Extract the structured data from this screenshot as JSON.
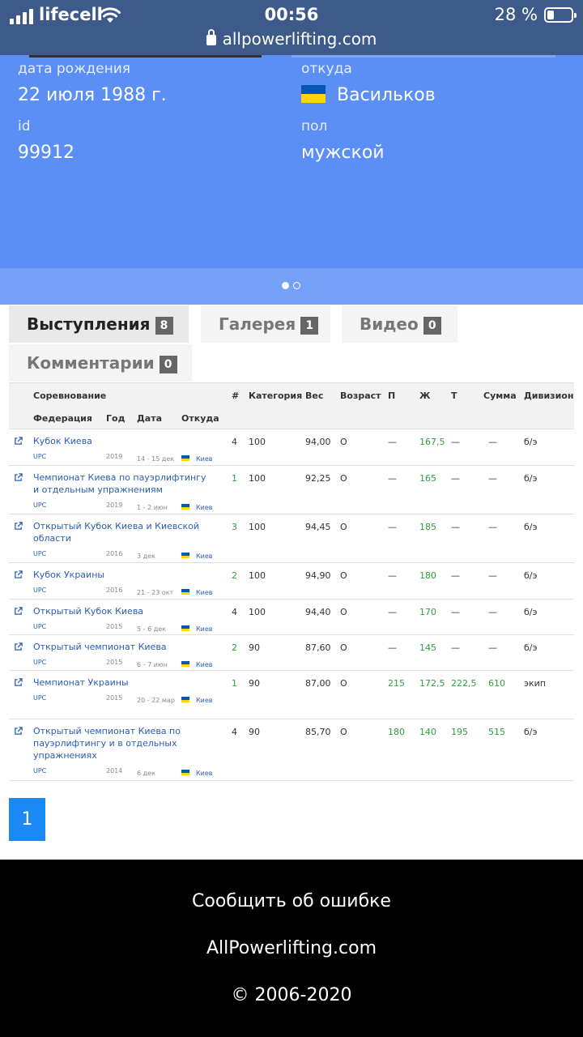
{
  "status_bar": {
    "carrier": "lifecell",
    "time": "00:56",
    "battery": "28 %",
    "url": "allpowerlifting.com"
  },
  "profile": {
    "birth_label": "дата рождения",
    "birth_value": "22 июля 1988 г.",
    "from_label": "откуда",
    "from_value": "Васильков",
    "id_label": "id",
    "id_value": "99912",
    "sex_label": "пол",
    "sex_value": "мужской"
  },
  "tabs": [
    {
      "label": "Выступления",
      "count": "8"
    },
    {
      "label": "Галерея",
      "count": "1"
    },
    {
      "label": "Видео",
      "count": "0"
    },
    {
      "label": "Комментарии",
      "count": "0"
    }
  ],
  "table": {
    "headers": {
      "competition": "Соревнование",
      "federation": "Федерация",
      "year": "Год",
      "date": "Дата",
      "from": "Откуда",
      "place": "#",
      "category": "Категория",
      "weight": "Вес",
      "age": "Возраст",
      "squat": "П",
      "bench": "Ж",
      "deadlift": "Т",
      "total": "Сумма",
      "division": "Дивизион"
    },
    "rows": [
      {
        "name": "Кубок Киева",
        "fed": "UPC",
        "year": "2019",
        "date": "14 - 15 дек",
        "city": "Киев",
        "place": "4",
        "cat": "100",
        "weight": "94,00",
        "age": "O",
        "squat": "—",
        "bench": "167,5",
        "dead": "—",
        "total": "—",
        "div": "б/э"
      },
      {
        "name": "Чемпионат Киева по пауэрлифтингу и отдельным упражнениям",
        "fed": "UPC",
        "year": "2019",
        "date": "1 - 2 июн",
        "city": "Киев",
        "place": "1",
        "cat": "100",
        "weight": "92,25",
        "age": "O",
        "squat": "—",
        "bench": "165",
        "dead": "—",
        "total": "—",
        "div": "б/э"
      },
      {
        "name": "Открытый Кубок Киева и Киевской области",
        "fed": "UPC",
        "year": "2016",
        "date": "3 дек",
        "city": "Киев",
        "place": "3",
        "cat": "100",
        "weight": "94,45",
        "age": "O",
        "squat": "—",
        "bench": "185",
        "dead": "—",
        "total": "—",
        "div": "б/э"
      },
      {
        "name": "Кубок Украины",
        "fed": "UPC",
        "year": "2016",
        "date": "21 - 23 окт",
        "city": "Киев",
        "place": "2",
        "cat": "100",
        "weight": "94,90",
        "age": "O",
        "squat": "—",
        "bench": "180",
        "dead": "—",
        "total": "—",
        "div": "б/э"
      },
      {
        "name": "Открытый Кубок Киева",
        "fed": "UPC",
        "year": "2015",
        "date": "5 - 6 дек",
        "city": "Киев",
        "place": "4",
        "cat": "100",
        "weight": "94,40",
        "age": "O",
        "squat": "—",
        "bench": "170",
        "dead": "—",
        "total": "—",
        "div": "б/э"
      },
      {
        "name": "Открытый чемпионат Киева",
        "fed": "UPC",
        "year": "2015",
        "date": "6 - 7 июн",
        "city": "Киев",
        "place": "2",
        "cat": "90",
        "weight": "87,60",
        "age": "O",
        "squat": "—",
        "bench": "145",
        "dead": "—",
        "total": "—",
        "div": "б/э"
      },
      {
        "name": "Чемпионат Украины",
        "fed": "UPC",
        "year": "2015",
        "date": "20 - 22 мар",
        "city": "Киев",
        "place": "1",
        "cat": "90",
        "weight": "87,00",
        "age": "O",
        "squat": "215",
        "bench": "172,5",
        "dead": "222,5",
        "total": "610",
        "div": "экип"
      },
      {
        "name": "Открытый чемпионат Киева по пауэрлифтингу и в отдельных упражнениях",
        "fed": "UPC",
        "year": "2014",
        "date": "6 дек",
        "city": "Киев",
        "place": "4",
        "cat": "90",
        "weight": "85,70",
        "age": "O",
        "squat": "180",
        "bench": "140",
        "dead": "195",
        "total": "515",
        "div": "б/э"
      }
    ]
  },
  "pager": {
    "current": "1"
  },
  "footer": {
    "report": "Сообщить об ошибке",
    "site": "AllPowerlifting.com",
    "copyright": "© 2006-2020"
  }
}
